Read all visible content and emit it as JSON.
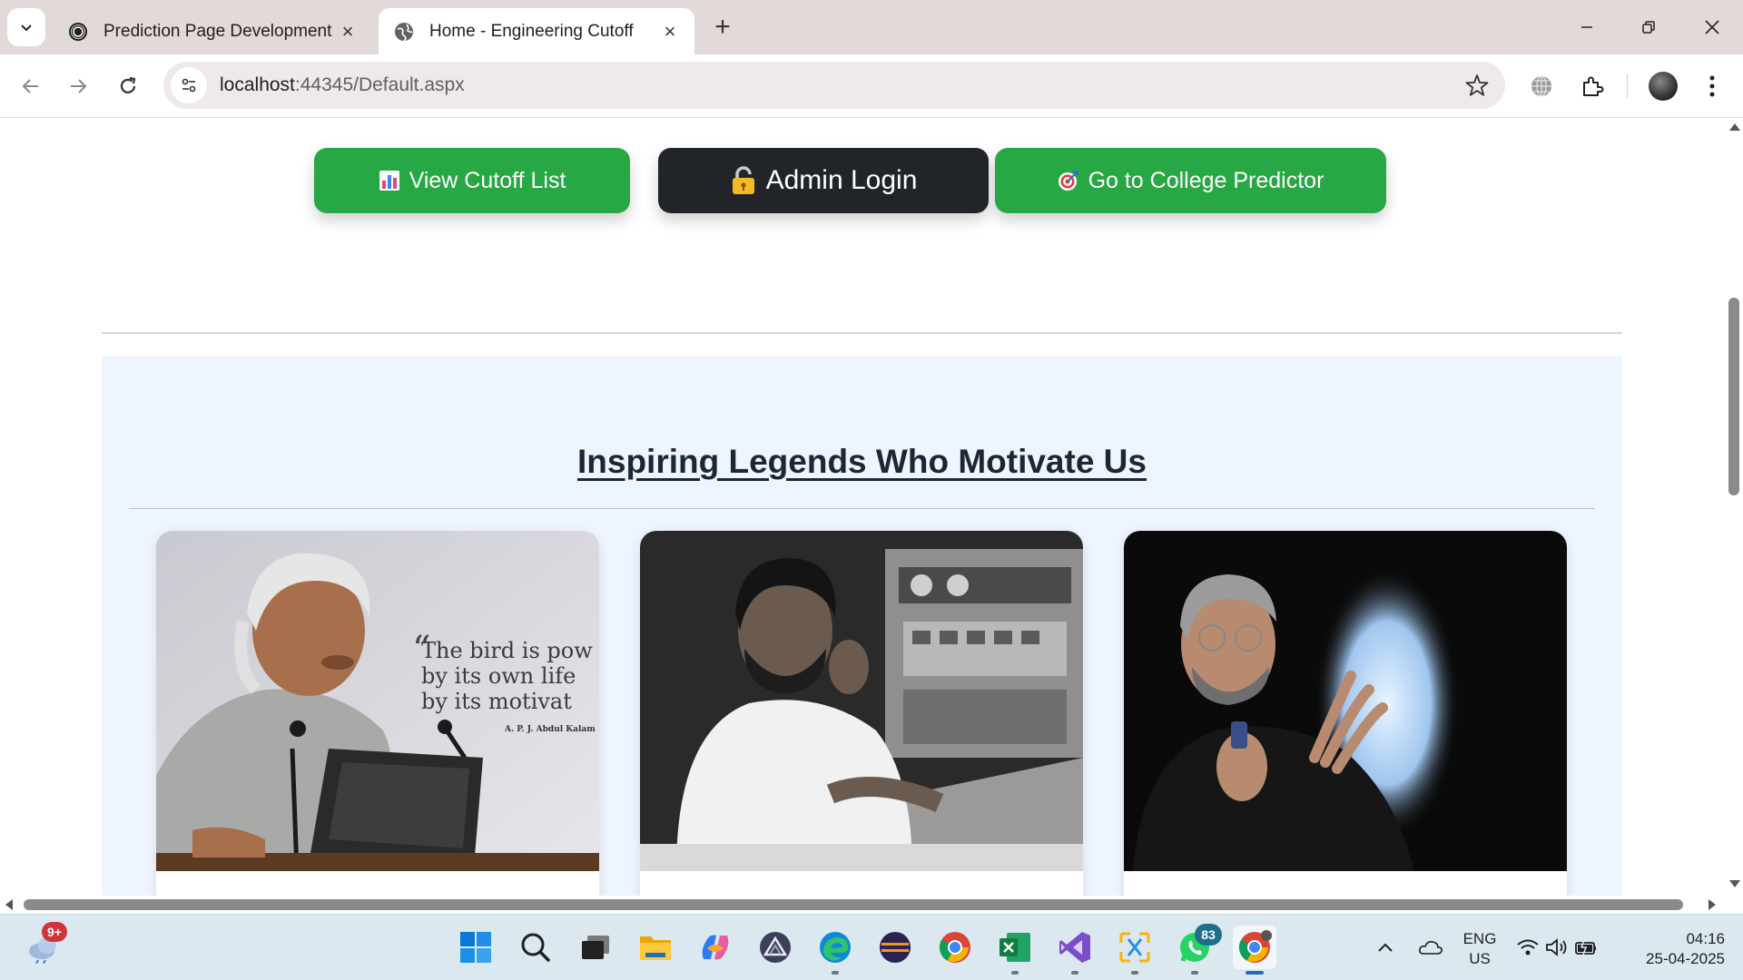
{
  "browser": {
    "tabs": [
      {
        "title": "Prediction Page Development",
        "active": false,
        "favicon": "openai-icon"
      },
      {
        "title": "Home - Engineering Cutoff",
        "active": true,
        "favicon": "globe-icon"
      }
    ],
    "url_host": "localhost",
    "url_rest": ":44345/Default.aspx"
  },
  "page": {
    "buttons": {
      "view_cutoff": "View Cutoff List",
      "admin_login": "Admin Login",
      "college_predictor": "Go to College Predictor"
    },
    "legends": {
      "title": "Inspiring Legends Who Motivate Us",
      "cards": [
        {
          "photo": "legend-photo-1",
          "quote_lines": [
            "The bird is pow",
            "by its own life",
            "by its motivat"
          ],
          "quote_author": "A. P. J. Abdul Kalam"
        },
        {
          "photo": "legend-photo-2"
        },
        {
          "photo": "legend-photo-3"
        }
      ]
    }
  },
  "taskbar": {
    "weather_badge": "9+",
    "whatsapp_badge": "83",
    "language_line1": "ENG",
    "language_line2": "US",
    "time": "04:16",
    "date": "25-04-2025"
  },
  "colors": {
    "button_green": "#28a745",
    "button_dark": "#212529",
    "legends_bg": "#eef5ff",
    "tabstrip_bg": "#e3d9d9"
  }
}
